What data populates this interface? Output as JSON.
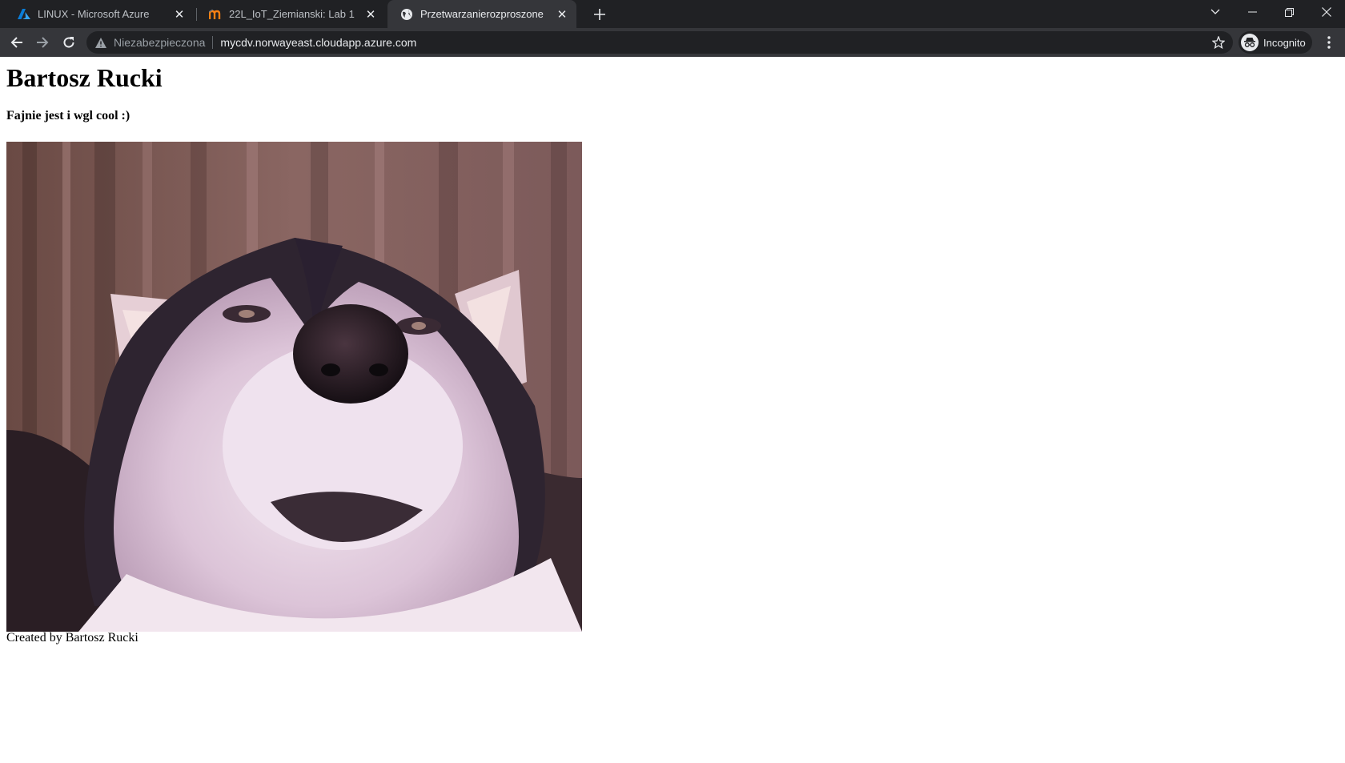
{
  "browser": {
    "tabs": [
      {
        "title": "LINUX - Microsoft Azure",
        "favicon": "azure-logo-icon",
        "active": false
      },
      {
        "title": "22L_IoT_Ziemianski: Lab 1",
        "favicon": "moodle-logo-icon",
        "active": false
      },
      {
        "title": "Przetwarzanierozproszone",
        "favicon": "globe-icon",
        "active": true
      }
    ],
    "address_bar": {
      "security_label": "Niezabezpieczona",
      "url": "mycdv.norwayeast.cloudapp.azure.com"
    },
    "profile_label": "Incognito"
  },
  "page": {
    "heading": "Bartosz Rucki",
    "subheading": "Fajnie jest i wgl cool :)",
    "image_alt": "husky dog close-up",
    "footer": "Created by Bartosz Rucki"
  },
  "colors": {
    "chrome_dark": "#202124",
    "chrome_toolbar": "#35363a",
    "chrome_text": "#e8eaed",
    "page_background": "#ffffff"
  }
}
